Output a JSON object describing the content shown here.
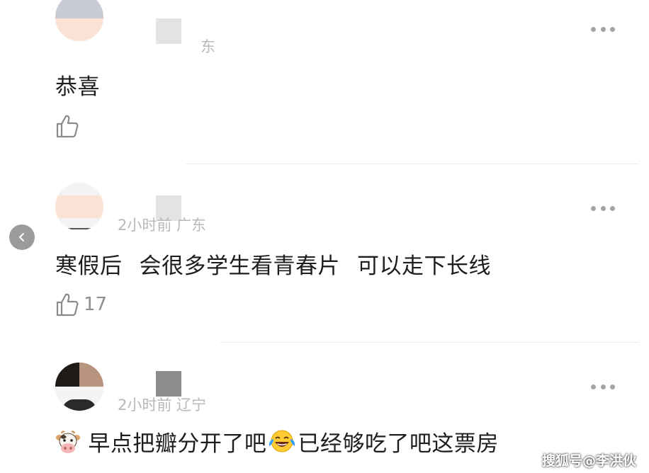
{
  "comments": [
    {
      "location": "东",
      "text": "恭喜",
      "like_count": ""
    },
    {
      "time_location": "2小时前 广东",
      "text_part1": "寒假后",
      "text_part2": "会很多学生看青春片",
      "text_part3": "可以走下长线",
      "like_count": "17"
    },
    {
      "time_location": "2小时前 辽宁",
      "text_part1": "早点把瓣分开了吧",
      "text_part2": "已经够吃了吧这票房"
    }
  ],
  "icons": {
    "like": "thumbs-up-icon",
    "more": "more-dots-icon",
    "back": "chevron-left-icon",
    "cow_emoji": "cow-face-icon",
    "laugh_emoji": "tears-of-joy-icon"
  },
  "watermark": "搜狐号@李洪伙",
  "colors": {
    "meta_text": "#b8b8bd",
    "body_text": "#1e1e1e",
    "like_count": "#8e8e93"
  }
}
